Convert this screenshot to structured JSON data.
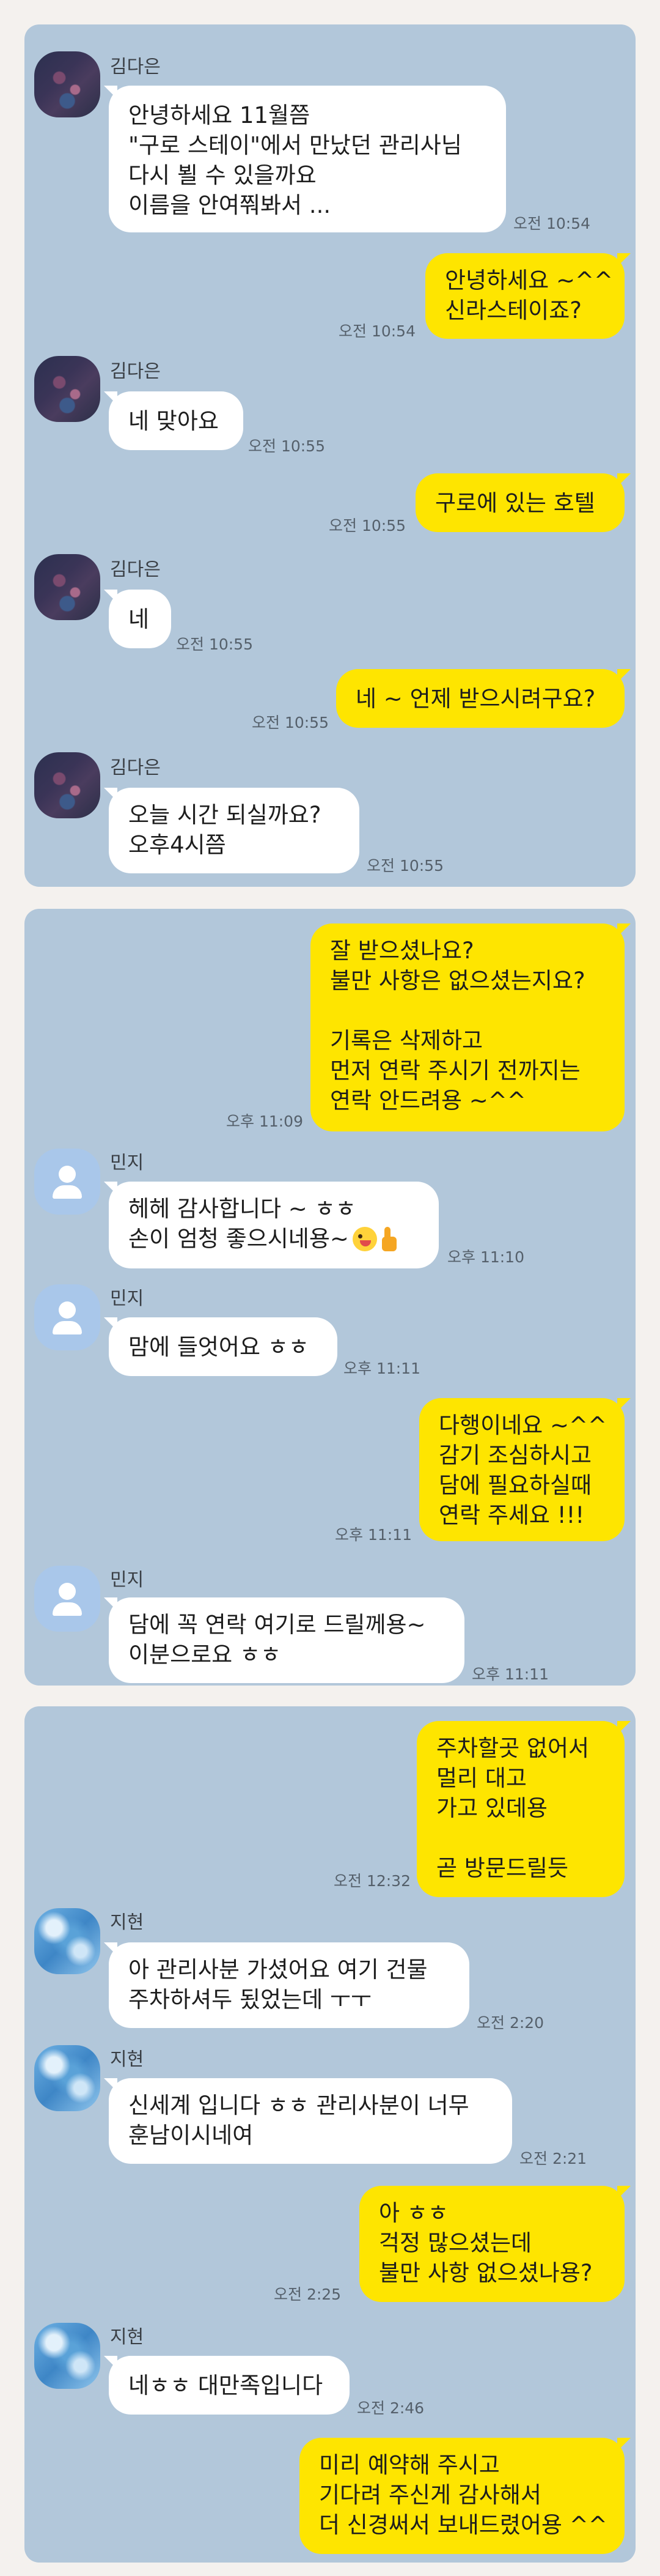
{
  "conversations": [
    {
      "messages": [
        {
          "dir": "in",
          "sender": "김다은",
          "lines": [
            "안녕하세요 11월쯤",
            "\"구로 스테이\"에서 만났던 관리사님",
            "다시 뵐 수 있을까요",
            "이름을 안여쭤봐서 ..."
          ],
          "time": "오전 10:54"
        },
        {
          "dir": "out",
          "lines": [
            "안녕하세요 ~^^",
            "신라스테이죠?"
          ],
          "time": "오전 10:54"
        },
        {
          "dir": "in",
          "sender": "김다은",
          "lines": [
            "네 맞아요"
          ],
          "time": "오전 10:55"
        },
        {
          "dir": "out",
          "lines": [
            "구로에 있는 호텔"
          ],
          "time": "오전 10:55"
        },
        {
          "dir": "in",
          "sender": "김다은",
          "lines": [
            "네"
          ],
          "time": "오전 10:55"
        },
        {
          "dir": "out",
          "lines": [
            "네 ~ 언제 받으시려구요?"
          ],
          "time": "오전 10:55"
        },
        {
          "dir": "in",
          "sender": "김다은",
          "lines": [
            "오늘  시간 되실까요?",
            "오후4시쯤"
          ],
          "time": "오전 10:55"
        }
      ]
    },
    {
      "messages": [
        {
          "dir": "out",
          "lines": [
            "잘 받으셨나요?",
            "불만 사항은 없으셨는지요?",
            "",
            "기록은 삭제하고",
            "먼저 연락 주시기 전까지는",
            "연락 안드려용 ~^^"
          ],
          "time": "오후 11:09"
        },
        {
          "dir": "in",
          "sender": "민지",
          "lines": [
            "헤헤 감사합니다 ~ ㅎㅎ",
            "손이 엄청 좋으시네용~"
          ],
          "emoji": [
            "winking-tongue-face-emoji",
            "thumbs-up-emoji"
          ],
          "time": "오후 11:10"
        },
        {
          "dir": "in",
          "sender": "민지",
          "lines": [
            "맘에 들엇어요 ㅎㅎ"
          ],
          "time": "오후 11:11"
        },
        {
          "dir": "out",
          "lines": [
            "다행이네요 ~^^",
            "감기 조심하시고",
            "담에 필요하실때",
            "연락 주세요 !!!"
          ],
          "time": "오후 11:11"
        },
        {
          "dir": "in",
          "sender": "민지",
          "lines": [
            "담에 꼭 연락 여기로 드릴께용~",
            "이분으로요 ㅎㅎ"
          ],
          "time": "오후 11:11"
        }
      ]
    },
    {
      "messages": [
        {
          "dir": "out",
          "lines": [
            "주차할곳 없어서",
            "멀리 대고",
            "가고 있데용",
            "",
            "곧 방문드릴듯"
          ],
          "time": "오전 12:32"
        },
        {
          "dir": "in",
          "sender": "지현",
          "lines": [
            "아 관리사분 가셨어요 여기 건물",
            "주차하셔두 됬었는데 ㅜㅜ"
          ],
          "time": "오전 2:20"
        },
        {
          "dir": "in",
          "sender": "지현",
          "lines": [
            "신세계 입니다 ㅎㅎ 관리사분이 너무",
            "훈남이시네여"
          ],
          "time": "오전 2:21"
        },
        {
          "dir": "out",
          "lines": [
            "아 ㅎㅎ",
            "걱정 많으셨는데",
            "불만 사항 없으셨나용?"
          ],
          "time": "오전 2:25"
        },
        {
          "dir": "in",
          "sender": "지현",
          "lines": [
            "네ㅎㅎ 대만족입니다"
          ],
          "time": "오전 2:46"
        },
        {
          "dir": "out",
          "lines": [
            "미리 예약해 주시고",
            "기다려 주신게 감사해서",
            "더 신경써서 보내드렸어용 ^^"
          ],
          "time": ""
        }
      ]
    }
  ],
  "avatars": {
    "김다은": "pixelated-photo",
    "민지": "default-person-icon",
    "지현": "blurred-photo"
  },
  "colors": {
    "panel_bg": "#b2c7da",
    "incoming_bubble": "#ffffff",
    "outgoing_bubble": "#fee500",
    "page_bg": "#f4f1ee"
  }
}
